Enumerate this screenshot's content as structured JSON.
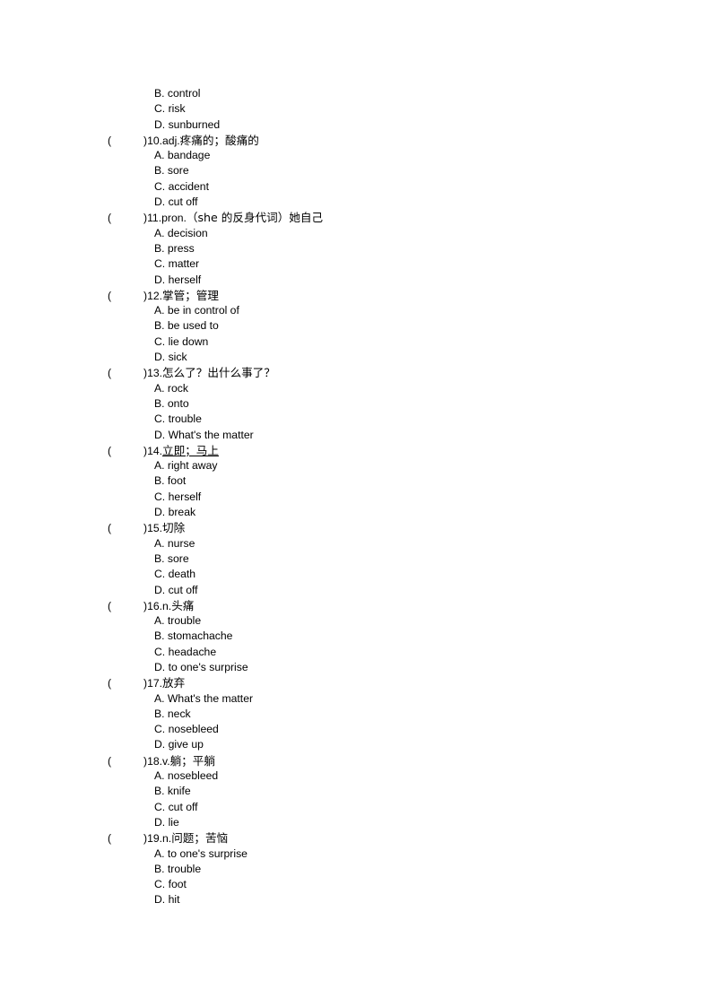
{
  "document": {
    "type": "vocabulary-multiple-choice-worksheet",
    "page_background": "#ffffff",
    "text_color": "#000000"
  },
  "continued_options": [
    {
      "label": "B.",
      "text": "control"
    },
    {
      "label": "C.",
      "text": "risk"
    },
    {
      "label": "D.",
      "text": "sunburned"
    }
  ],
  "questions": [
    {
      "open_paren": "(",
      "close_paren": ")",
      "number": "10.",
      "pos": "adj.",
      "prompt": "疼痛的；酸痛的",
      "underlined": false,
      "options": [
        {
          "label": "A.",
          "text": "bandage"
        },
        {
          "label": "B.",
          "text": "sore"
        },
        {
          "label": "C.",
          "text": "accident"
        },
        {
          "label": "D.",
          "text": "cut off"
        }
      ]
    },
    {
      "open_paren": "(",
      "close_paren": ")",
      "number": "11.",
      "pos": "pron.",
      "prompt": "（she 的反身代词）她自己",
      "underlined": false,
      "options": [
        {
          "label": "A.",
          "text": "decision"
        },
        {
          "label": "B.",
          "text": "press"
        },
        {
          "label": "C.",
          "text": "matter"
        },
        {
          "label": "D.",
          "text": "herself"
        }
      ]
    },
    {
      "open_paren": "(",
      "close_paren": ")",
      "number": "12.",
      "pos": "",
      "prompt": "掌管；管理",
      "underlined": false,
      "options": [
        {
          "label": "A.",
          "text": "be in control of"
        },
        {
          "label": "B.",
          "text": "be used to"
        },
        {
          "label": "C.",
          "text": "lie down"
        },
        {
          "label": "D.",
          "text": "sick"
        }
      ]
    },
    {
      "open_paren": "(",
      "close_paren": ")",
      "number": "13.",
      "pos": "",
      "prompt": "怎么了？出什么事了？",
      "underlined": false,
      "options": [
        {
          "label": "A.",
          "text": "rock"
        },
        {
          "label": "B.",
          "text": "onto"
        },
        {
          "label": "C.",
          "text": "trouble"
        },
        {
          "label": "D.",
          "text": "What's the matter"
        }
      ]
    },
    {
      "open_paren": "(",
      "close_paren": ")",
      "number": "14.",
      "pos": "",
      "prompt": "立即；马上",
      "underlined": true,
      "options": [
        {
          "label": "A.",
          "text": "right away"
        },
        {
          "label": "B.",
          "text": "foot"
        },
        {
          "label": "C.",
          "text": "herself"
        },
        {
          "label": "D.",
          "text": "break"
        }
      ]
    },
    {
      "open_paren": "(",
      "close_paren": ")",
      "number": "15.",
      "pos": "",
      "prompt": "切除",
      "underlined": false,
      "options": [
        {
          "label": "A.",
          "text": "nurse"
        },
        {
          "label": "B.",
          "text": "sore"
        },
        {
          "label": "C.",
          "text": "death"
        },
        {
          "label": "D.",
          "text": "cut off"
        }
      ]
    },
    {
      "open_paren": "(",
      "close_paren": ")",
      "number": "16.",
      "pos": "n.",
      "prompt": "头痛",
      "underlined": false,
      "options": [
        {
          "label": "A.",
          "text": "trouble"
        },
        {
          "label": "B.",
          "text": "stomachache"
        },
        {
          "label": "C.",
          "text": "headache"
        },
        {
          "label": "D.",
          "text": "to one's surprise"
        }
      ]
    },
    {
      "open_paren": "(",
      "close_paren": ")",
      "number": "17.",
      "pos": "",
      "prompt": "放弃",
      "underlined": false,
      "options": [
        {
          "label": "A.",
          "text": "What's the matter"
        },
        {
          "label": "B.",
          "text": "neck"
        },
        {
          "label": "C.",
          "text": "nosebleed"
        },
        {
          "label": "D.",
          "text": "give up"
        }
      ]
    },
    {
      "open_paren": "(",
      "close_paren": ")",
      "number": "18.",
      "pos": "v.",
      "prompt": "躺；平躺",
      "underlined": false,
      "options": [
        {
          "label": "A.",
          "text": "nosebleed"
        },
        {
          "label": "B.",
          "text": "knife"
        },
        {
          "label": "C.",
          "text": "cut off"
        },
        {
          "label": "D.",
          "text": "lie"
        }
      ]
    },
    {
      "open_paren": "(",
      "close_paren": ")",
      "number": "19.",
      "pos": "n.",
      "prompt": "问题；苦恼",
      "underlined": false,
      "options": [
        {
          "label": "A.",
          "text": "to one's surprise"
        },
        {
          "label": "B.",
          "text": "trouble"
        },
        {
          "label": "C.",
          "text": "foot"
        },
        {
          "label": "D.",
          "text": "hit"
        }
      ]
    }
  ]
}
